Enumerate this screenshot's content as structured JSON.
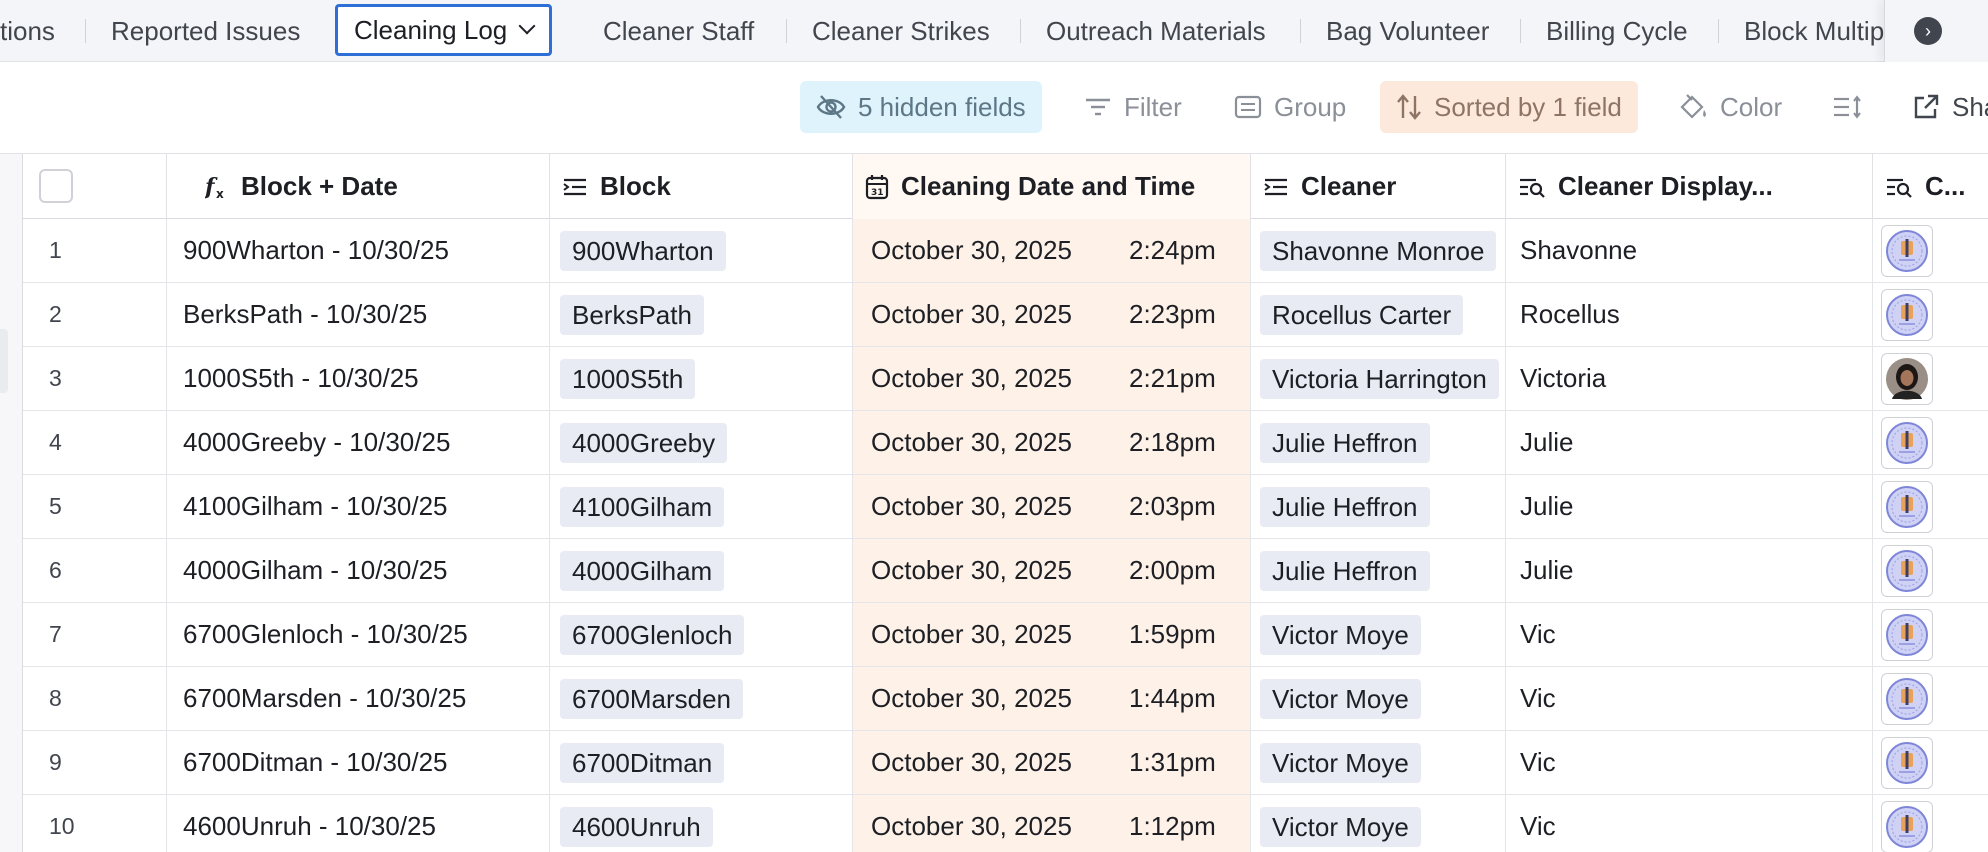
{
  "tabs": [
    {
      "label": "tions"
    },
    {
      "label": "Reported Issues"
    },
    {
      "label": "Cleaning Log",
      "active": true
    },
    {
      "label": "Cleaner Staff"
    },
    {
      "label": "Cleaner Strikes"
    },
    {
      "label": "Outreach Materials"
    },
    {
      "label": "Bag Volunteer"
    },
    {
      "label": "Billing Cycle"
    },
    {
      "label": "Block Multip"
    }
  ],
  "toolbar": {
    "hidden_fields": "5 hidden fields",
    "filter": "Filter",
    "group": "Group",
    "sorted": "Sorted by 1 field",
    "color": "Color",
    "share": "Sha"
  },
  "columns": {
    "block_date": "Block + Date",
    "block": "Block",
    "cleaning_date": "Cleaning Date and Time",
    "cleaner": "Cleaner",
    "cleaner_display": "Cleaner Display...",
    "cleaner_photo": "C..."
  },
  "rows": [
    {
      "num": "1",
      "block_date": "900Wharton - 10/30/25",
      "block": "900Wharton",
      "date": "October 30, 2025",
      "time": "2:24pm",
      "cleaner": "Shavonne Monroe",
      "display": "Shavonne",
      "avatar": "placeholder-avatar-icon"
    },
    {
      "num": "2",
      "block_date": "BerksPath - 10/30/25",
      "block": "BerksPath",
      "date": "October 30, 2025",
      "time": "2:23pm",
      "cleaner": "Rocellus Carter",
      "display": "Rocellus",
      "avatar": "placeholder-avatar-icon"
    },
    {
      "num": "3",
      "block_date": "1000S5th - 10/30/25",
      "block": "1000S5th",
      "date": "October 30, 2025",
      "time": "2:21pm",
      "cleaner": "Victoria Harrington",
      "display": "Victoria",
      "avatar": "photo-avatar-icon"
    },
    {
      "num": "4",
      "block_date": "4000Greeby - 10/30/25",
      "block": "4000Greeby",
      "date": "October 30, 2025",
      "time": "2:18pm",
      "cleaner": "Julie Heffron",
      "display": "Julie",
      "avatar": "placeholder-avatar-icon"
    },
    {
      "num": "5",
      "block_date": "4100Gilham - 10/30/25",
      "block": "4100Gilham",
      "date": "October 30, 2025",
      "time": "2:03pm",
      "cleaner": "Julie Heffron",
      "display": "Julie",
      "avatar": "placeholder-avatar-icon"
    },
    {
      "num": "6",
      "block_date": "4000Gilham - 10/30/25",
      "block": "4000Gilham",
      "date": "October 30, 2025",
      "time": "2:00pm",
      "cleaner": "Julie Heffron",
      "display": "Julie",
      "avatar": "placeholder-avatar-icon"
    },
    {
      "num": "7",
      "block_date": "6700Glenloch - 10/30/25",
      "block": "6700Glenloch",
      "date": "October 30, 2025",
      "time": "1:59pm",
      "cleaner": "Victor Moye",
      "display": "Vic",
      "avatar": "placeholder-avatar-icon"
    },
    {
      "num": "8",
      "block_date": "6700Marsden - 10/30/25",
      "block": "6700Marsden",
      "date": "October 30, 2025",
      "time": "1:44pm",
      "cleaner": "Victor Moye",
      "display": "Vic",
      "avatar": "placeholder-avatar-icon"
    },
    {
      "num": "9",
      "block_date": "6700Ditman - 10/30/25",
      "block": "6700Ditman",
      "date": "October 30, 2025",
      "time": "1:31pm",
      "cleaner": "Victor Moye",
      "display": "Vic",
      "avatar": "placeholder-avatar-icon"
    },
    {
      "num": "10",
      "block_date": "4600Unruh - 10/30/25",
      "block": "4600Unruh",
      "date": "October 30, 2025",
      "time": "1:12pm",
      "cleaner": "Victor Moye",
      "display": "Vic",
      "avatar": "placeholder-avatar-icon"
    }
  ],
  "colors": {
    "active_tab_border": "#2d6fd6",
    "hidden_fields_bg": "#def3fb",
    "sorted_bg": "#fde9dc",
    "sorted_column_bg": "#fdf1e8",
    "chip_bg": "#e9ebf4"
  }
}
